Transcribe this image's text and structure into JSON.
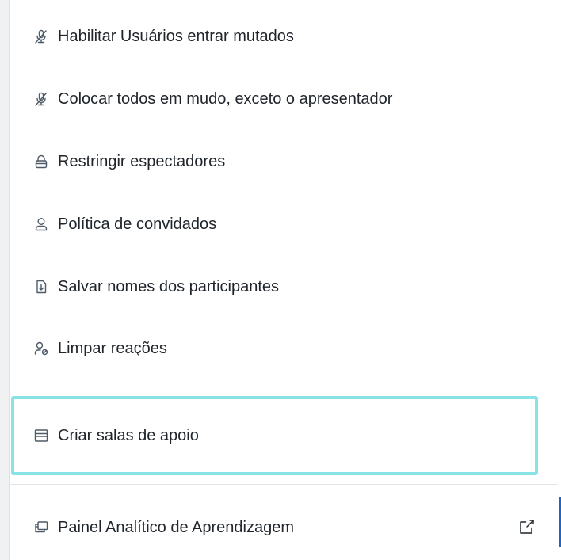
{
  "menu": {
    "items": [
      {
        "id": "mute-on-join",
        "label": "Habilitar Usuários entrar mutados",
        "icon": "mic-off-icon"
      },
      {
        "id": "mute-all-except-presenter",
        "label": "Colocar todos em mudo, exceto o apresentador",
        "icon": "mic-off-icon"
      },
      {
        "id": "lock-viewers",
        "label": "Restringir espectadores",
        "icon": "lock-icon"
      },
      {
        "id": "guest-policy",
        "label": "Política de convidados",
        "icon": "user-icon"
      },
      {
        "id": "save-participant-names",
        "label": "Salvar nomes dos participantes",
        "icon": "download-file-icon"
      },
      {
        "id": "clear-reactions",
        "label": "Limpar reações",
        "icon": "user-clear-icon"
      },
      {
        "id": "create-breakout-rooms",
        "label": "Criar salas de apoio",
        "icon": "rooms-icon"
      },
      {
        "id": "learning-dashboard",
        "label": "Painel Analítico de Aprendizagem",
        "icon": "dashboard-icon"
      }
    ],
    "highlighted_item": "Criar salas de apoio",
    "external_link_icon": "external-link-icon"
  },
  "colors": {
    "highlight_border": "#88e3e7",
    "text": "#1f252b",
    "icon": "#4e5a66",
    "accent": "#1b66c9"
  }
}
